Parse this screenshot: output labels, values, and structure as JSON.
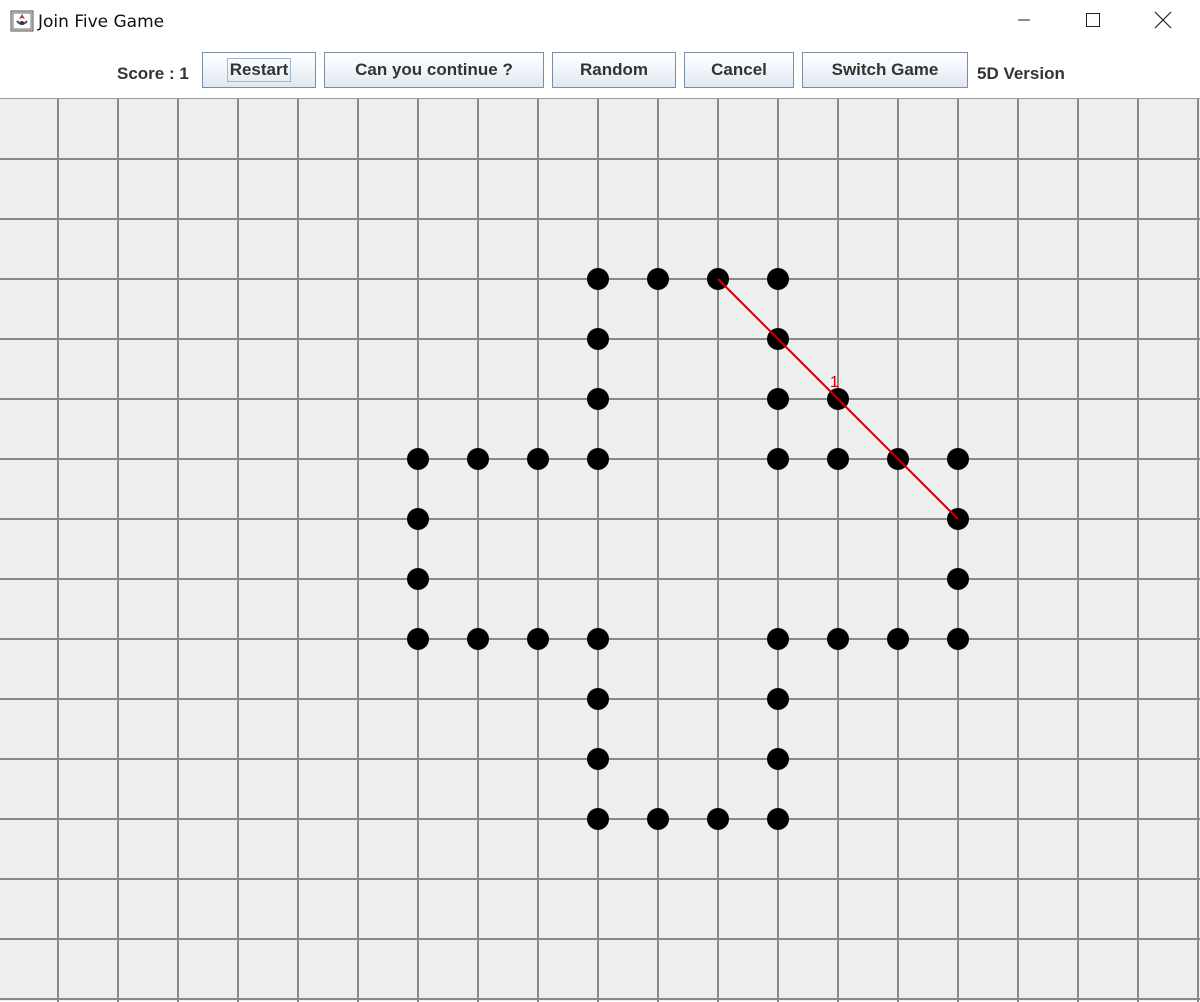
{
  "window": {
    "title": "Join Five Game",
    "icon": "java-app-icon",
    "controls": [
      "minimize-icon",
      "maximize-icon",
      "close-icon"
    ]
  },
  "toolbar": {
    "score_label": "Score : 1",
    "buttons": {
      "restart": "Restart",
      "continue": "Can you continue ?",
      "random": "Random",
      "cancel": "Cancel",
      "switch": "Switch Game"
    },
    "version_label": "5D Version"
  },
  "board": {
    "grid_columns": 20,
    "grid_rows": 15,
    "grid_color": "#888888",
    "background": "#eeeeee",
    "dot_color": "#000000",
    "line_color": "#cc0000",
    "dots": [
      [
        10,
        3
      ],
      [
        11,
        3
      ],
      [
        12,
        3
      ],
      [
        13,
        3
      ],
      [
        10,
        4
      ],
      [
        13,
        4
      ],
      [
        10,
        5
      ],
      [
        13,
        5
      ],
      [
        14,
        5
      ],
      [
        7,
        6
      ],
      [
        8,
        6
      ],
      [
        9,
        6
      ],
      [
        10,
        6
      ],
      [
        13,
        6
      ],
      [
        14,
        6
      ],
      [
        15,
        6
      ],
      [
        16,
        6
      ],
      [
        7,
        7
      ],
      [
        16,
        7
      ],
      [
        7,
        8
      ],
      [
        16,
        8
      ],
      [
        7,
        9
      ],
      [
        8,
        9
      ],
      [
        9,
        9
      ],
      [
        10,
        9
      ],
      [
        13,
        9
      ],
      [
        14,
        9
      ],
      [
        15,
        9
      ],
      [
        16,
        9
      ],
      [
        10,
        10
      ],
      [
        13,
        10
      ],
      [
        10,
        11
      ],
      [
        13,
        11
      ],
      [
        10,
        12
      ],
      [
        11,
        12
      ],
      [
        12,
        12
      ],
      [
        13,
        12
      ]
    ],
    "moves": [
      {
        "number": "1",
        "from": [
          12,
          3
        ],
        "to": [
          16,
          7
        ]
      }
    ]
  }
}
